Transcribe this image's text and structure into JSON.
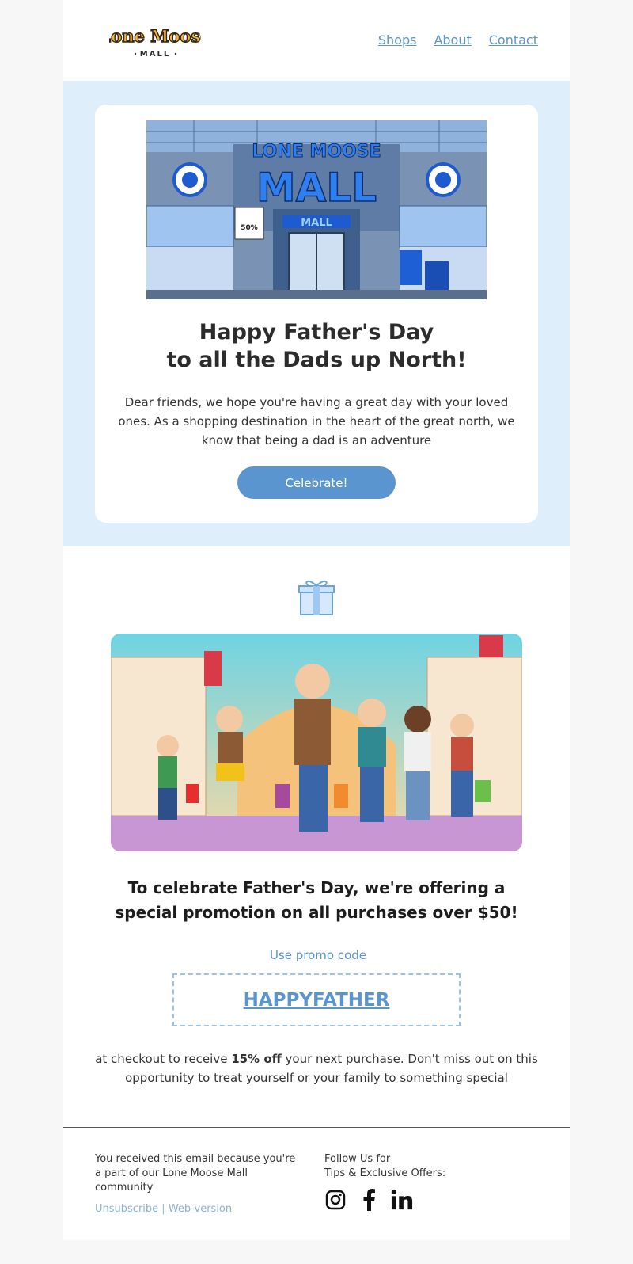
{
  "header": {
    "logo": {
      "line1": "Lone Moose",
      "line2": "MALL"
    },
    "nav": [
      "Shops",
      "About",
      "Contact"
    ]
  },
  "hero": {
    "image": {
      "sign_main": "LONE MOOSE",
      "sign_sub": "MALL",
      "door_sign": "MALL",
      "poster": "50%",
      "icon": "moose-emblem-icon"
    },
    "title_line1": "Happy Father's Day",
    "title_line2": "to all the Dads up North!",
    "body": "Dear friends, we hope you're having a great day with your loved ones. As a shopping destination in the heart of the great north, we know that being a dad is an adventure",
    "button_label": "Celebrate!"
  },
  "promo": {
    "icon": "gift-icon",
    "title": "To celebrate Father's Day, we're offering a special promotion on all purchases over $50!",
    "label": "Use promo code",
    "code": "HAPPYFATHER",
    "body_before": "at checkout to receive ",
    "body_bold": "15% off",
    "body_after": " your next purchase. Don't miss out on this opportunity to treat yourself or your family to something special"
  },
  "footer": {
    "left_text": "You received this email because you're a part of our Lone Moose Mall community",
    "unsubscribe": "Unsubscribe",
    "separator": "|",
    "web_version": "Web-version",
    "right_line1": "Follow Us for",
    "right_line2": "Tips & Exclusive Offers:",
    "socials": [
      "instagram-icon",
      "facebook-icon",
      "linkedin-icon"
    ]
  },
  "colors": {
    "accent": "#5b95cf",
    "hero_bg": "#dfeefb",
    "page_bg": "#f7f7f7"
  }
}
